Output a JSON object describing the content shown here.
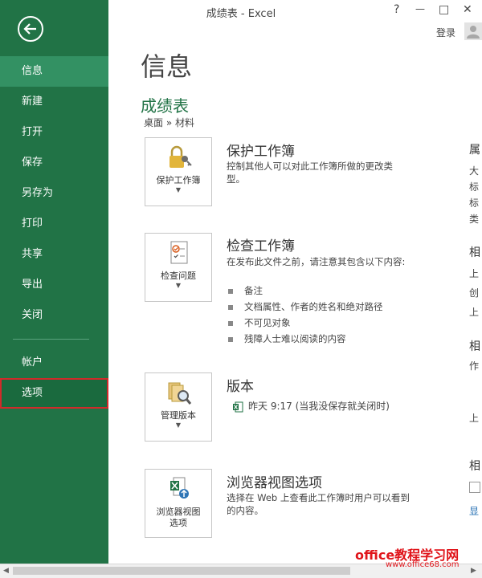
{
  "window": {
    "title": "成绩表 - Excel",
    "help": "?",
    "minimize": "—",
    "maximize": "□",
    "close": "✕",
    "login": "登录"
  },
  "sidebar": {
    "items": [
      "信息",
      "新建",
      "打开",
      "保存",
      "另存为",
      "打印",
      "共享",
      "导出",
      "关闭"
    ],
    "items2": [
      "帐户",
      "选项"
    ]
  },
  "main": {
    "title": "信息",
    "doc_name": "成绩表",
    "breadcrumb": "桌面 » 材料",
    "protect": {
      "button": "保护工作簿",
      "title": "保护工作簿",
      "desc": "控制其他人可以对此工作簿所做的更改类型。"
    },
    "inspect": {
      "button": "检查问题",
      "title": "检查工作簿",
      "desc": "在发布此文件之前，请注意其包含以下内容:",
      "bullets": [
        "备注",
        "文档属性、作者的姓名和绝对路径",
        "不可见对象",
        "残障人士难以阅读的内容"
      ]
    },
    "versions": {
      "button": "管理版本",
      "title": "版本",
      "entry": "昨天 9:17 (当我没保存就关闭时)"
    },
    "browser": {
      "button_line1": "浏览器视图",
      "button_line2": "选项",
      "title": "浏览器视图选项",
      "desc": "选择在 Web 上查看此工作簿时用户可以看到的内容。"
    }
  },
  "props": {
    "c1": "属",
    "c2": "大",
    "c3": "标",
    "c4": "标",
    "c5": "类",
    "c6": "相",
    "c7": "上",
    "c8": "创",
    "c9": "上",
    "c10": "相",
    "c11": "作",
    "c12": "上",
    "c13": "相",
    "c14": "显"
  },
  "watermark": {
    "line1": "office教程学习网",
    "line2": "www.office68.com"
  },
  "colors": {
    "accent": "#217346",
    "selected_outline": "#d12a2a"
  }
}
